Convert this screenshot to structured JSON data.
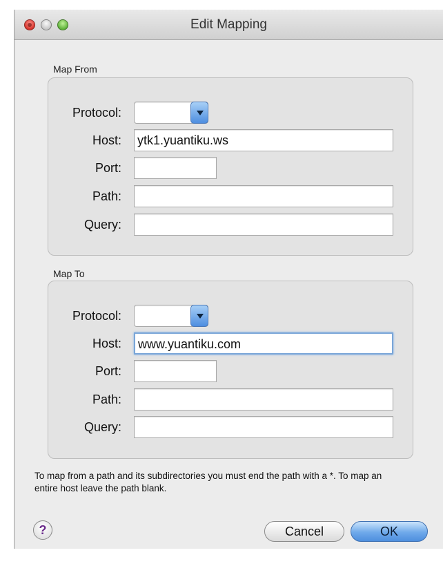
{
  "window": {
    "title": "Edit Mapping"
  },
  "map_from": {
    "section_label": "Map From",
    "protocol_label": "Protocol:",
    "protocol_value": "",
    "host_label": "Host:",
    "host_value": "ytk1.yuantiku.ws",
    "port_label": "Port:",
    "port_value": "",
    "path_label": "Path:",
    "path_value": "",
    "query_label": "Query:",
    "query_value": ""
  },
  "map_to": {
    "section_label": "Map To",
    "protocol_label": "Protocol:",
    "protocol_value": "",
    "host_label": "Host:",
    "host_value": "www.yuantiku.com",
    "port_label": "Port:",
    "port_value": "",
    "path_label": "Path:",
    "path_value": "",
    "query_label": "Query:",
    "query_value": ""
  },
  "help_text": "To map from a path and its subdirectories you must end the path with a *. To map an entire host leave the path blank.",
  "buttons": {
    "help": "?",
    "cancel": "Cancel",
    "ok": "OK"
  },
  "colors": {
    "default_button": "#6fa9ea",
    "focus_ring": "#7fb0e8",
    "close_light": "#d7352c",
    "zoom_light": "#5fb23a"
  }
}
